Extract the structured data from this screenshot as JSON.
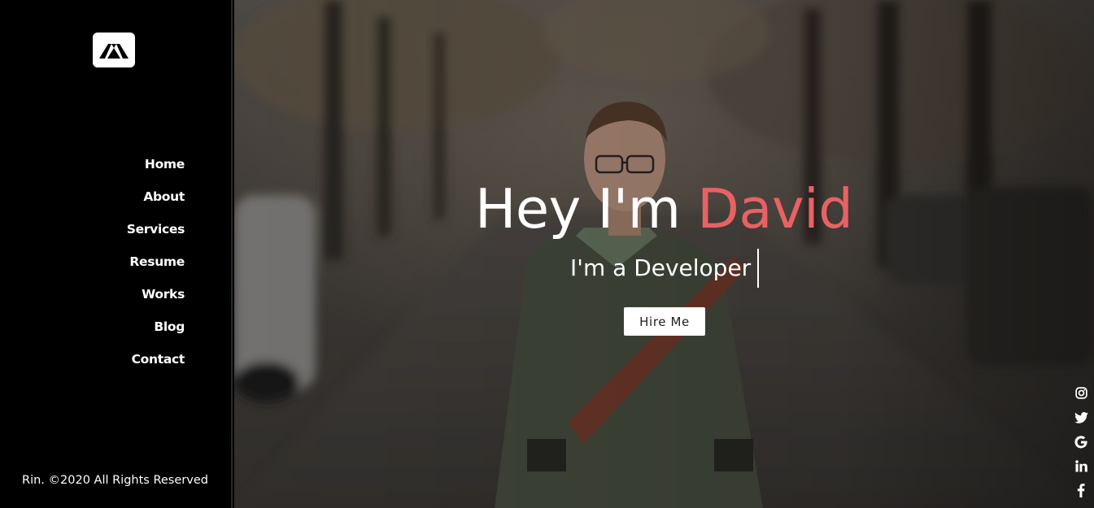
{
  "brand": {
    "logo_icon": "rin-logo-icon",
    "logo_text": "Rin"
  },
  "nav": {
    "items": [
      {
        "label": "Home"
      },
      {
        "label": "About"
      },
      {
        "label": "Services"
      },
      {
        "label": "Resume"
      },
      {
        "label": "Works"
      },
      {
        "label": "Blog"
      },
      {
        "label": "Contact"
      }
    ]
  },
  "footer": {
    "copyright": "Rin. ©2020 All Rights Reserved"
  },
  "hero": {
    "greeting": "Hey I'm ",
    "name": "David",
    "subtitle": "I'm a Developer",
    "cta_label": "Hire Me",
    "accent_color": "#e86264"
  },
  "social": [
    {
      "icon": "instagram-icon"
    },
    {
      "icon": "twitter-icon"
    },
    {
      "icon": "google-icon"
    },
    {
      "icon": "linkedin-icon"
    },
    {
      "icon": "facebook-icon"
    }
  ]
}
